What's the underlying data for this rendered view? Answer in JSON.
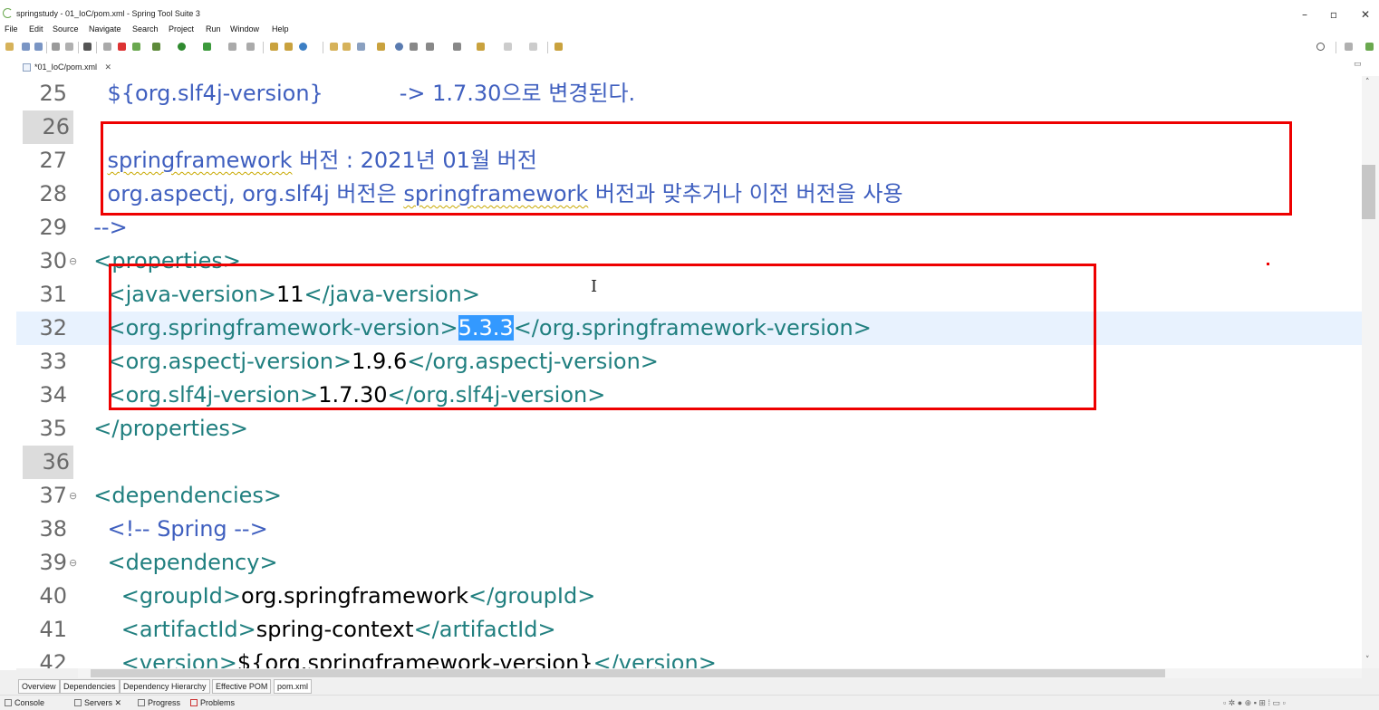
{
  "window": {
    "title": "springstudy - 01_IoC/pom.xml - Spring Tool Suite 3",
    "controls": [
      "–",
      "▫",
      "✕"
    ]
  },
  "menu": [
    "File",
    "Edit",
    "Source",
    "Navigate",
    "Search",
    "Project",
    "Run",
    "Window",
    "Help"
  ],
  "editor_tab": {
    "label": "*01_IoC/pom.xml",
    "close": "✕"
  },
  "lines": [
    {
      "num": "25",
      "segments": [
        {
          "t": "    ${org.slf4j-version}           -> 1.7.30으로 변경된다.",
          "c": "comment"
        }
      ]
    },
    {
      "num": "26",
      "bar": true,
      "segments": []
    },
    {
      "num": "27",
      "segments": [
        {
          "t": "    ",
          "c": "comment"
        },
        {
          "t": "springframework",
          "c": "comment",
          "squig": true
        },
        {
          "t": " 버전 : 2021년 01월 버전",
          "c": "comment"
        }
      ]
    },
    {
      "num": "28",
      "segments": [
        {
          "t": "    org.aspectj, org.slf4j 버전은 ",
          "c": "comment"
        },
        {
          "t": "springframework",
          "c": "comment",
          "squig": true
        },
        {
          "t": " 버전과 맞추거나 이전 버전을 사용",
          "c": "comment"
        }
      ]
    },
    {
      "num": "29",
      "segments": [
        {
          "t": "  -->",
          "c": "comment"
        }
      ]
    },
    {
      "num": "30",
      "fold": true,
      "segments": [
        {
          "t": "  <properties>",
          "c": "tag"
        }
      ]
    },
    {
      "num": "31",
      "segments": [
        {
          "t": "    <java-version>",
          "c": "tag"
        },
        {
          "t": "11",
          "c": "text"
        },
        {
          "t": "</java-version>",
          "c": "tag"
        }
      ]
    },
    {
      "num": "32",
      "hl": true,
      "segments": [
        {
          "t": "    <org.springframework-version>",
          "c": "tag"
        },
        {
          "t": "5.3.3",
          "c": "sel"
        },
        {
          "t": "</org.springframework-version>",
          "c": "tag"
        }
      ]
    },
    {
      "num": "33",
      "segments": [
        {
          "t": "    <org.aspectj-version>",
          "c": "tag"
        },
        {
          "t": "1.9.6",
          "c": "text"
        },
        {
          "t": "</org.aspectj-version>",
          "c": "tag"
        }
      ]
    },
    {
      "num": "34",
      "segments": [
        {
          "t": "    <org.slf4j-version>",
          "c": "tag"
        },
        {
          "t": "1.7.30",
          "c": "text"
        },
        {
          "t": "</org.slf4j-version>",
          "c": "tag"
        }
      ]
    },
    {
      "num": "35",
      "segments": [
        {
          "t": "  </properties>",
          "c": "tag"
        }
      ]
    },
    {
      "num": "36",
      "bar": true,
      "segments": []
    },
    {
      "num": "37",
      "fold": true,
      "segments": [
        {
          "t": "  <dependencies>",
          "c": "tag"
        }
      ]
    },
    {
      "num": "38",
      "segments": [
        {
          "t": "    <!-- Spring -->",
          "c": "comment"
        }
      ]
    },
    {
      "num": "39",
      "fold": true,
      "segments": [
        {
          "t": "    <dependency>",
          "c": "tag"
        }
      ]
    },
    {
      "num": "40",
      "segments": [
        {
          "t": "      <groupId>",
          "c": "tag"
        },
        {
          "t": "org.springframework",
          "c": "text"
        },
        {
          "t": "</groupId>",
          "c": "tag"
        }
      ]
    },
    {
      "num": "41",
      "segments": [
        {
          "t": "      <artifactId>",
          "c": "tag"
        },
        {
          "t": "spring-context",
          "c": "text"
        },
        {
          "t": "</artifactId>",
          "c": "tag"
        }
      ]
    },
    {
      "num": "42",
      "segments": [
        {
          "t": "      <version>",
          "c": "tag"
        },
        {
          "t": "${org.springframework-version}",
          "c": "text"
        },
        {
          "t": "</version>",
          "c": "tag"
        }
      ]
    }
  ],
  "pom_tabs": [
    "Overview",
    "Dependencies",
    "Dependency Hierarchy",
    "Effective POM",
    "pom.xml"
  ],
  "active_pom_tab": "pom.xml",
  "views": [
    {
      "label": "Console",
      "close": ""
    },
    {
      "label": "Servers",
      "close": "✕"
    },
    {
      "label": "Progress",
      "close": ""
    },
    {
      "label": "Problems",
      "close": ""
    }
  ],
  "colors": {
    "comment": "#3f5fbf",
    "tag": "#207f7f",
    "text": "#000000",
    "selection": "#3399ff",
    "annotation": "#ee0000"
  }
}
